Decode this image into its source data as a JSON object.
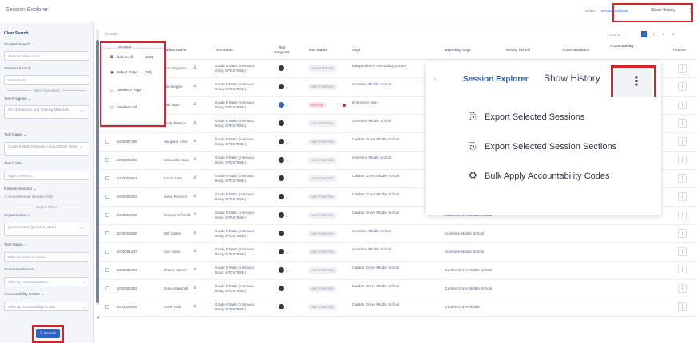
{
  "app": {
    "title": "Session Explorer"
  },
  "topbar": {
    "home": "Home",
    "current": "Session Explorer",
    "show_history": "Show History",
    "kebab": "⋮"
  },
  "sidebar": {
    "clear_search": "Clear Search",
    "student_search_label": "Student Search",
    "student_search_placeholder": "Student Name or ID",
    "session_search_label": "Session Search",
    "session_search_placeholder": "Session ID",
    "test_info_divider": "Test Information",
    "test_program_label": "Test Program",
    "test_program_value": "23-24 Interauto and Training Materials",
    "test_name_label": "Test Name",
    "test_name_value": "Grade 6 Math (Interauto Using SPDS Tests)",
    "test_code_label": "Test Code",
    "test_code_placeholder": "Type to search...",
    "remote_session_label": "Remote Session",
    "remote_session_checkbox": "Show Remote Session Only",
    "report_filters_divider": "Report Filters",
    "organization_label": "Organization",
    "organization_value": "pearson state (pearson_state)",
    "test_status_label": "Test Status",
    "test_status_placeholder": "Filter by Session status...",
    "accommodations_label": "Accommodations",
    "accommodations_placeholder": "Filter by Accommodation...",
    "accountability_label": "Accountability Codes",
    "accountability_placeholder": "Filter by Accountability Codes",
    "search_button": "Search"
  },
  "results": {
    "label": "Results",
    "pager_text": "1 to 20 of",
    "pages": [
      "1",
      "2",
      "3",
      "4"
    ]
  },
  "table": {
    "headers": {
      "student_id": "Student ID",
      "student_name": "Student Name",
      "test_name": "Test Name",
      "test_progress": "Test Progress",
      "test_status": "Test Status",
      "orgs": "Orgs",
      "reporting_orgs": "Reporting Orgs",
      "testing_school": "Testing School",
      "accommodation": "Accommodation",
      "accountability": "Accountability",
      "actions": "Actions"
    },
    "rows": [
      {
        "id": "",
        "name": "Ann Ferguson",
        "test": "Grade 6 Math (Interauto Using SPDS Tests)",
        "status": "NOT STARTED",
        "exited": false,
        "orgs": "Independence Secondary School",
        "reporting": "",
        "progress_blue": false
      },
      {
        "id": "",
        "name": "Ella Diegee",
        "test": "Grade 6 Math (Interauto Using SPDS Tests)",
        "status": "NOT STARTED",
        "exited": false,
        "orgs": "Sunshine Middle School",
        "reporting": "",
        "progress_blue": false
      },
      {
        "id": "",
        "name": "Mali Jaam",
        "test": "Grade 6 Math (Interauto Using SPDS Tests)",
        "status": "EXITED",
        "exited": true,
        "orgs": "Enterprise High",
        "reporting": "",
        "progress_blue": true
      },
      {
        "id": "",
        "name": "Emily Pierson",
        "test": "Grade 6 Math (Interauto Using SPDS Tests)",
        "status": "NOT STARTED",
        "exited": false,
        "orgs": "Sunshine Middle School",
        "reporting": "",
        "progress_blue": false
      },
      {
        "id": "1000007196",
        "name": "Margaret Kline",
        "test": "Grade 6 Math (Interauto Using SPDS Tests)",
        "status": "NOT STARTED",
        "exited": false,
        "orgs": "Garden Grove Middle School",
        "reporting": "",
        "progress_blue": false
      },
      {
        "id": "1000005665",
        "name": "Samantha Cain",
        "test": "Grade 6 Math (Interauto Using SPDS Tests)",
        "status": "NOT STARTED",
        "exited": false,
        "orgs": "Sunshine Middle School",
        "reporting": "",
        "progress_blue": false
      },
      {
        "id": "1000002847",
        "name": "Jacob Stan",
        "test": "Grade 6 Math (Interauto Using SPDS Tests)",
        "status": "NOT STARTED",
        "exited": false,
        "orgs": "Garden Grove Middle School",
        "reporting": "Garden Grove Middle School",
        "progress_blue": false
      },
      {
        "id": "1000005443",
        "name": "Jared Romero",
        "test": "Grade 6 Math (Interauto Using SPDS Tests)",
        "status": "NOT STARTED",
        "exited": false,
        "orgs": "Garden Grove Middle School",
        "reporting": "Garden Grove Middle School",
        "progress_blue": false
      },
      {
        "id": "1000005649",
        "name": "Edward Schmidt",
        "test": "Grade 6 Math (Interauto Using SPDS Tests)",
        "status": "NOT STARTED",
        "exited": false,
        "orgs": "Garden Grove Middle School",
        "reporting": "Garden Grove Middle School",
        "progress_blue": false
      },
      {
        "id": "1000005666",
        "name": "Will Sutton",
        "test": "Grade 6 Math (Interauto Using SPDS Tests)",
        "status": "NOT STARTED",
        "exited": false,
        "orgs": "Sunshine Middle School",
        "reporting": "Sunshine Middle School",
        "progress_blue": false
      },
      {
        "id": "1000001437",
        "name": "Eve Jones",
        "test": "Grade 6 Math (Interauto Using SPDS Tests)",
        "status": "NOT STARTED",
        "exited": false,
        "orgs": "Sunshine Middle School",
        "reporting": "Sunshine Middle School",
        "progress_blue": false
      },
      {
        "id": "1000001703",
        "name": "Shaun Steiner",
        "test": "Grade 6 Math (Interauto Using SPDS Tests)",
        "status": "NOT STARTED",
        "exited": false,
        "orgs": "Garden Grove Middle School",
        "reporting": "Garden Grove Middle School",
        "progress_blue": false
      },
      {
        "id": "1000002482",
        "name": "Sonia Marshall",
        "test": "Grade 6 Math (Interauto Using SPDS Tests)",
        "status": "NOT STARTED",
        "exited": false,
        "orgs": "Garden Grove Middle School",
        "reporting": "Garden Grove Middle School",
        "progress_blue": false
      },
      {
        "id": "1000005405",
        "name": "Kevin Hale",
        "test": "Grade 6 Math (Interauto Using SPDS Tests)",
        "status": "NOT STARTED",
        "exited": false,
        "orgs": "Garden Grove Middle School",
        "reporting": "Garden Grove Middle",
        "progress_blue": false
      }
    ]
  },
  "select_popover": {
    "select_all": "Select All",
    "select_all_count": "(150)",
    "select_page": "Select Page",
    "select_page_count": "(20)",
    "deselect_page": "Deselect Page",
    "deselect_all": "Deselect All"
  },
  "zoom": {
    "crumb": "Session Explorer",
    "show_history": "Show History",
    "kebab": "⋮",
    "menu": [
      "Export Selected Sessions",
      "Export Selected Session Sections",
      "Bulk Apply Accountability Codes"
    ]
  }
}
